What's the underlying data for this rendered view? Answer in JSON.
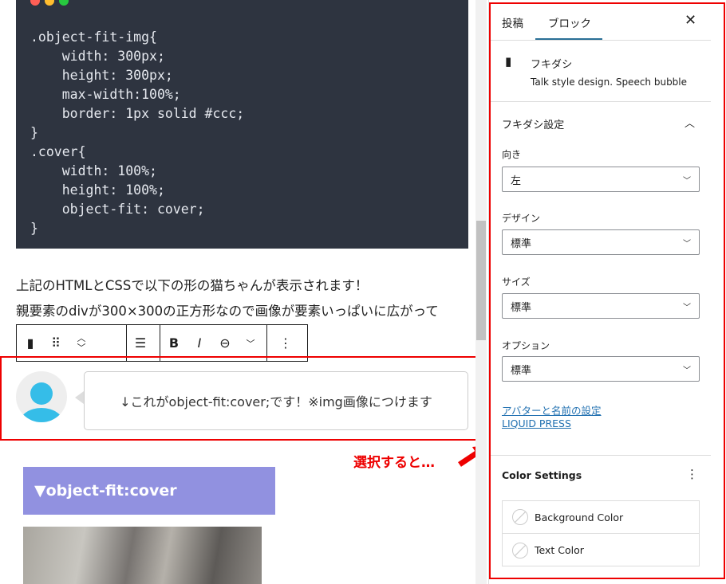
{
  "code_block": {
    "lines": [
      ".object-fit-img{",
      "    width: 300px;",
      "    height: 300px;",
      "    max-width:100%;",
      "    border: 1px solid #ccc;",
      "}",
      ".cover{",
      "    width: 100%;",
      "    height: 100%;",
      "    object-fit: cover;",
      "}"
    ]
  },
  "paragraph": {
    "line1": "上記のHTMLとCSSで以下の形の猫ちゃんが表示されます！",
    "line2": "親要素のdivが300×300の正方形なので画像が要素いっぱいに広がって"
  },
  "toolbar": {
    "bold": "B",
    "italic": "I"
  },
  "bubble": {
    "text": "↓これがobject-fit:cover;です！※img画像につけます"
  },
  "heading": {
    "text": "▼object-fit:cover"
  },
  "annotation": {
    "text": "選択すると…",
    "color": "#e00000"
  },
  "sidebar": {
    "tabs": [
      {
        "label": "投稿"
      },
      {
        "label": "ブロック",
        "active": true
      }
    ],
    "block": {
      "name": "フキダシ",
      "description": "Talk style design. Speech bubble"
    },
    "panel_title": "フキダシ設定",
    "fields": [
      {
        "label": "向き",
        "value": "左"
      },
      {
        "label": "デザイン",
        "value": "標準"
      },
      {
        "label": "サイズ",
        "value": "標準"
      },
      {
        "label": "オプション",
        "value": "標準"
      }
    ],
    "links": [
      "アバターと名前の設定",
      "LIQUID PRESS"
    ],
    "color_settings": {
      "title": "Color Settings",
      "items": [
        "Background Color",
        "Text Color"
      ]
    }
  },
  "colors": {
    "accent": "#2271b1",
    "tab_indicator": "#2a6f97",
    "code_bg": "#2e3440",
    "heading_bg": "#9191e0",
    "avatar": "#35bde8"
  }
}
